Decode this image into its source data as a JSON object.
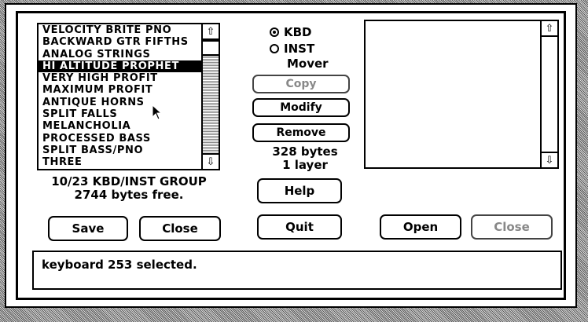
{
  "patch_list": {
    "items": [
      "VELOCITY BRITE PNO",
      "BACKWARD GTR FIFTHS",
      "ANALOG STRINGS",
      "HI ALTITUDE PROPHET",
      "VERY HIGH PROFIT",
      "MAXIMUM PROFIT",
      "ANTIQUE HORNS",
      "SPLIT FALLS",
      "MELANCHOLIA",
      "PROCESSED BASS",
      "SPLIT BASS/PNO",
      "THREE"
    ],
    "selected_index": 3
  },
  "group_info": {
    "line1": "10/23 KBD/INST GROUP",
    "line2": "2744 bytes free."
  },
  "mode": {
    "kbd_label": "KBD",
    "inst_label": "INST",
    "mover_label": "Mover",
    "selected": "KBD"
  },
  "buttons": {
    "copy": "Copy",
    "modify": "Modify",
    "remove": "Remove",
    "help": "Help",
    "quit": "Quit",
    "save": "Save",
    "close_left": "Close",
    "open": "Open",
    "close_right": "Close"
  },
  "size_info": {
    "bytes": "328 bytes",
    "layers": "1 layer"
  },
  "status_message": "keyboard 253 selected.",
  "icons": {
    "scroll_up": "up-arrow-icon",
    "scroll_down": "down-arrow-icon",
    "cursor": "pointer-cursor-icon"
  }
}
